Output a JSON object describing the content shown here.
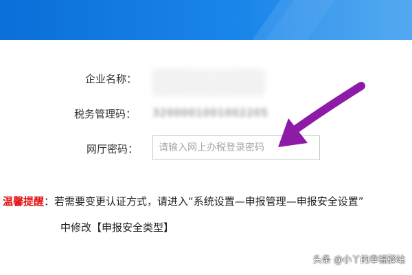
{
  "form": {
    "company_label": "企业名称：",
    "tax_code_label": "税务管理码：",
    "tax_code_value": "3200001001002205",
    "password_label": "网厅密码：",
    "password_placeholder": "请输入网上办税登录密码"
  },
  "tip": {
    "title": "温馨提醒",
    "line1": "：若需要变更认证方式，请进入“系统设置—申报管理—申报安全设置”",
    "line2": "中修改【申报安全类型】"
  },
  "watermark": {
    "text": "头条 @小丫的幸福驿站"
  },
  "colors": {
    "header_blue": "#0a6fd8",
    "arrow_purple": "#8e1aa8",
    "tip_red": "#e01010"
  }
}
